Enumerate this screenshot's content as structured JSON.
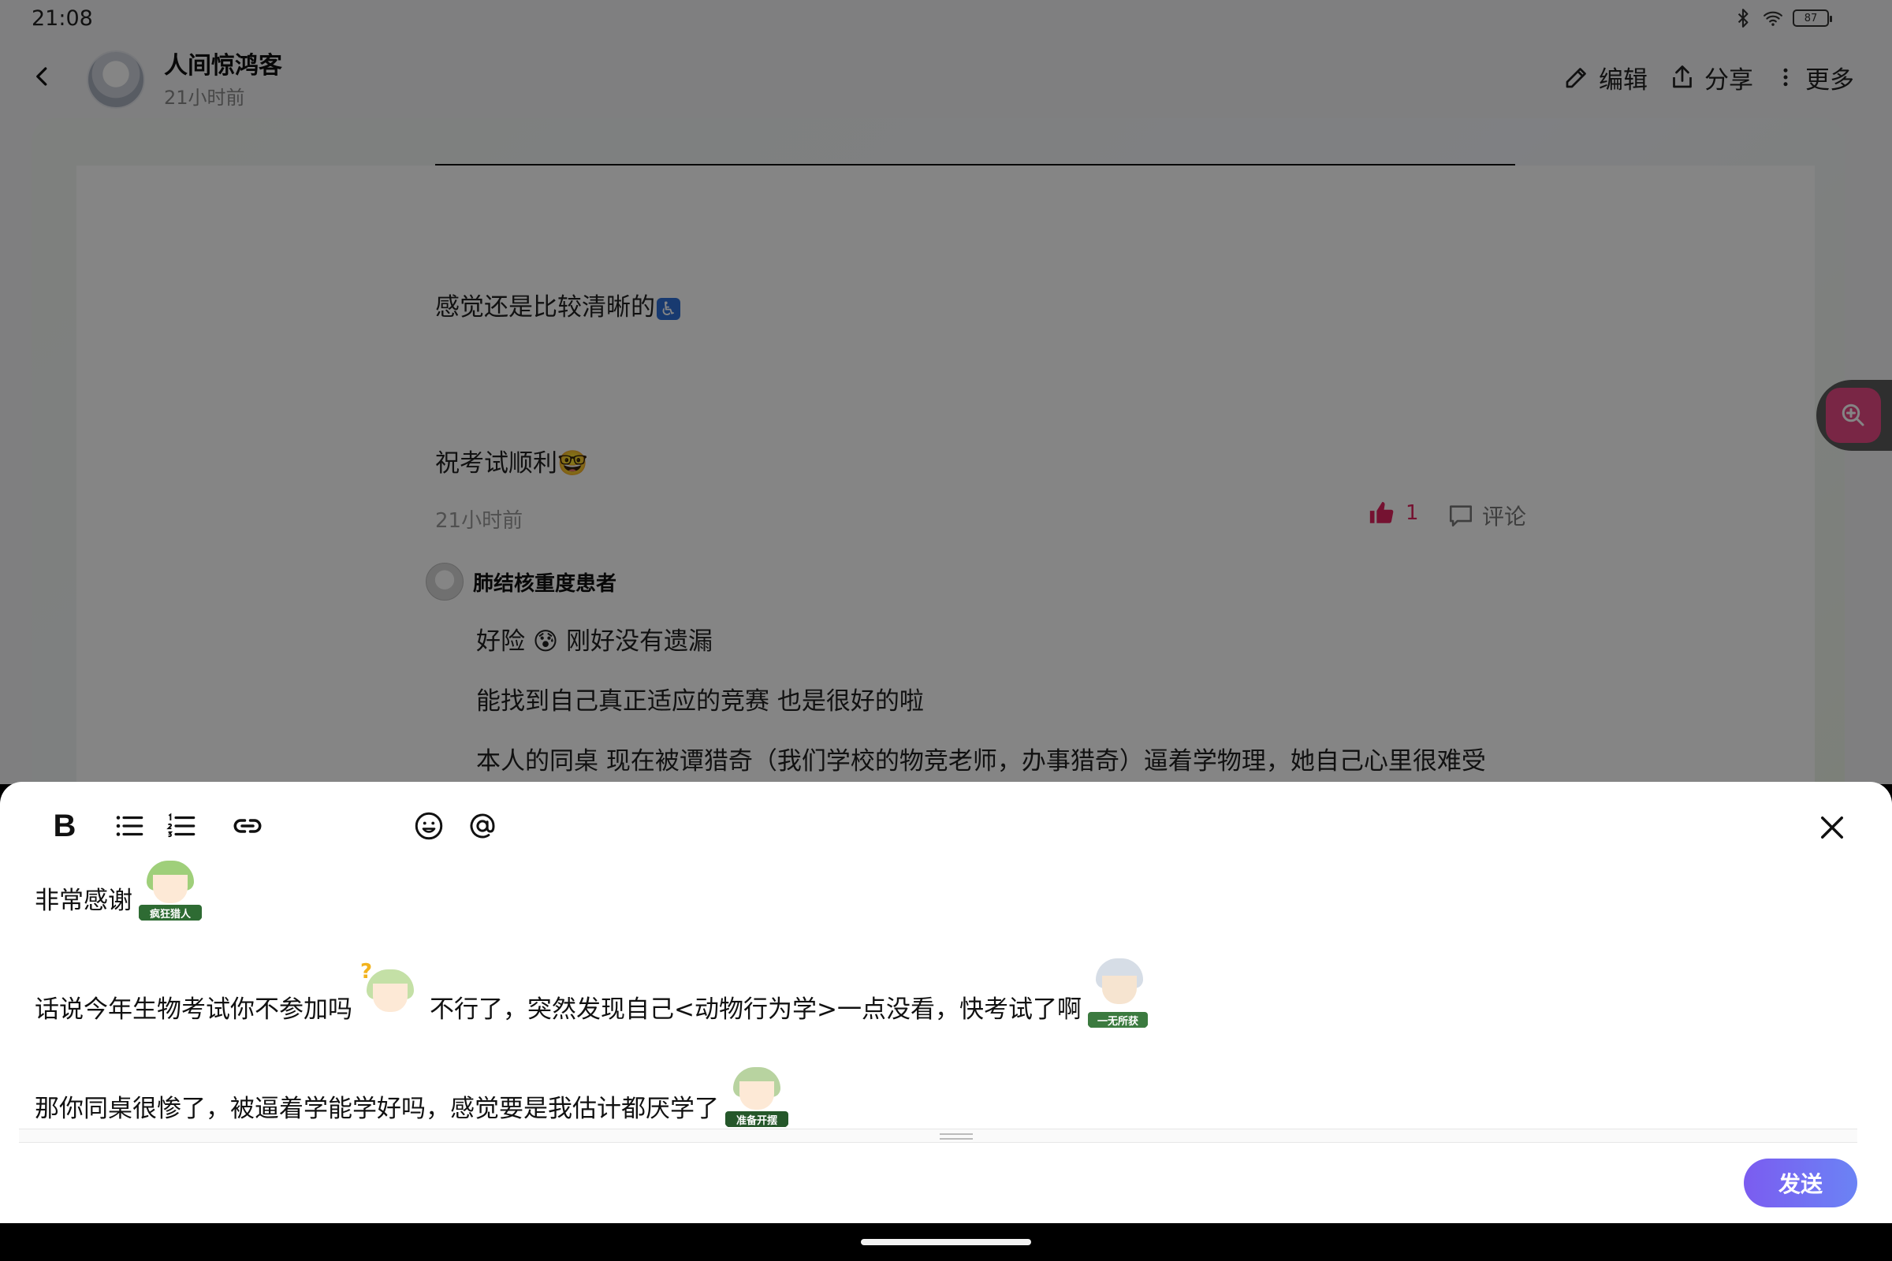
{
  "status_bar": {
    "time": "21:08",
    "battery": "87"
  },
  "header": {
    "author_name": "人间惊鸿客",
    "post_time": "21小时前",
    "actions": {
      "edit": "编辑",
      "share": "分享",
      "more": "更多"
    }
  },
  "post": {
    "paragraph1": "感觉还是比较清晰的",
    "paragraph1_emoji": "♿",
    "paragraph2": "祝考试顺利",
    "paragraph2_emoji": "🤓",
    "time": "21小时前",
    "likes": "1",
    "comment_label": "评论"
  },
  "reply": {
    "author": "肺结核重度患者",
    "line1_a": "好险",
    "line1_emoji": "😰",
    "line1_b": "刚好没有遗漏",
    "line2": "能找到自己真正适应的竞赛 也是很好的啦",
    "line3": "本人的同桌 现在被谭猎奇（我们学校的物竞老师，办事猎奇）逼着学物理，她自己心里很难受"
  },
  "editor": {
    "toolbar": {
      "bold": "B"
    },
    "line1": "非常感谢",
    "line1_sticker": "疯狂猎人",
    "line2_a": "话说今年生物考试你不参加吗",
    "line2_sticker_a": "?",
    "line2_b": "不行了，突然发现自己<动物行为学>一点没看，快考试了啊",
    "line2_sticker_b": "一无所获",
    "line3": "那你同桌很惨了，被逼着学能学好吗，感觉要是我估计都厌学了",
    "line3_sticker": "准备开摆",
    "send_label": "发送"
  },
  "icons": [
    "back-icon",
    "edit-icon",
    "share-icon",
    "more-icon",
    "like-icon",
    "comment-icon",
    "zoom-in-icon",
    "bold-icon",
    "bullet-list-icon",
    "numbered-list-icon",
    "link-icon",
    "emoji-icon",
    "mention-icon",
    "close-icon",
    "bluetooth-icon",
    "wifi-icon",
    "battery-icon"
  ],
  "colors": {
    "accent_pink": "#e84a85",
    "send_gradient_start": "#7b5cf0",
    "send_gradient_end": "#6b83f5",
    "like_red": "#e0245e"
  }
}
